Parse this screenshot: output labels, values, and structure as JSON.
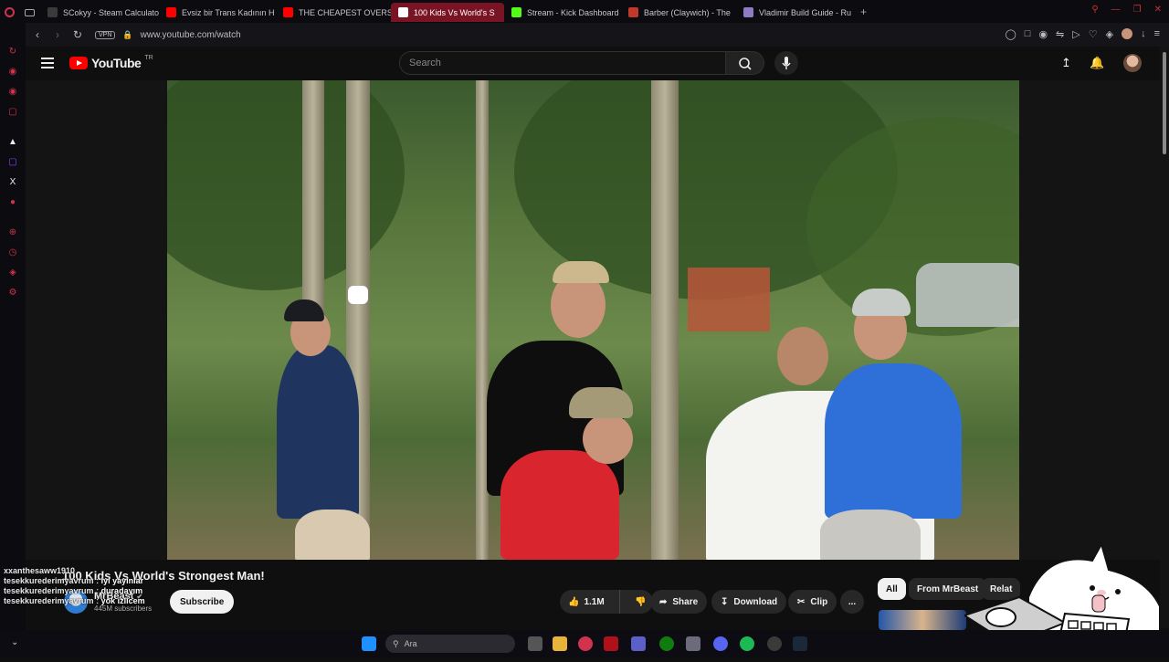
{
  "browser": {
    "tabs": [
      {
        "title": "SCokyy - Steam Calculato",
        "fav_color": "#3a3a3a",
        "active": false
      },
      {
        "title": "Evsiz bir Trans Kadının H",
        "fav_color": "#ff0000",
        "active": false
      },
      {
        "title": "THE CHEAPEST OVERSE",
        "fav_color": "#ff0000",
        "active": false
      },
      {
        "title": "100 Kids Vs World's S",
        "fav_color": "#ffffff",
        "active": true
      },
      {
        "title": "Stream - Kick Dashboard",
        "fav_color": "#53fc18",
        "active": false
      },
      {
        "title": "Barber (Claywich) - The",
        "fav_color": "#c0392b",
        "active": false
      },
      {
        "title": "Vladimir Build Guide - Ru",
        "fav_color": "#8e7cc3",
        "active": false
      }
    ],
    "new_tab": "+",
    "vpn_label": "VPN",
    "url": "www.youtube.com/watch"
  },
  "youtube": {
    "logo_text": "YouTube",
    "region": "TR",
    "search_placeholder": "Search",
    "video": {
      "title": "100 Kids Vs World's Strongest Man!",
      "channel": "MrBeast",
      "subscribers": "445M subscribers",
      "subscribe_label": "Subscribe",
      "likes": "1.1M",
      "share_label": "Share",
      "download_label": "Download",
      "clip_label": "Clip",
      "more_label": "..."
    },
    "chips": [
      {
        "label": "All",
        "active": true
      },
      {
        "label": "From MrBeast",
        "active": false
      },
      {
        "label": "Relat",
        "active": false
      }
    ]
  },
  "chat": [
    {
      "user": "xxanthesaww1910",
      "message": ""
    },
    {
      "user": "tesekkurederimyavrum",
      "message": "iyi yayınlar"
    },
    {
      "user": "tesekkurederimyavrum",
      "message": "duradayım"
    },
    {
      "user": "tesekkurederimyavrum",
      "message": "yok izlicem"
    }
  ],
  "taskbar": {
    "search_placeholder": "Ara"
  },
  "colors": {
    "opera_red": "#d0334d",
    "youtube_red": "#ff0000",
    "active_tab": "#7a1424"
  }
}
